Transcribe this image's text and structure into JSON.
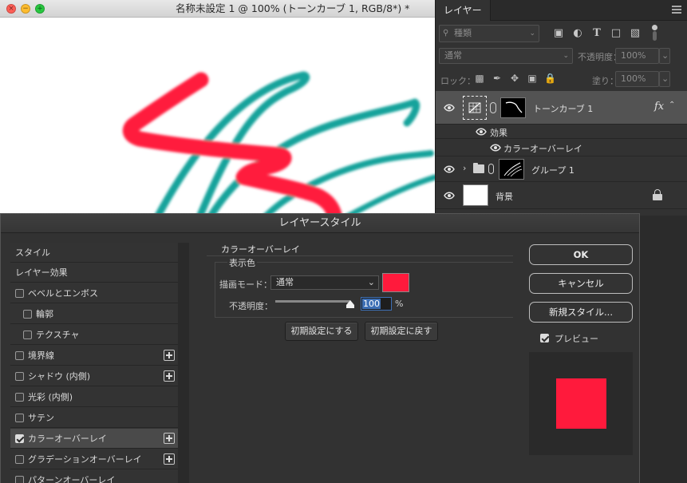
{
  "document": {
    "title": "名称未設定 1 @ 100% (トーンカーブ 1, RGB/8*) *",
    "window_controls": {
      "close": "×",
      "minimize": "−",
      "maximize": "+"
    }
  },
  "layers_panel": {
    "tab": "レイヤー",
    "filter_placeholder": "種類",
    "blend_mode": "通常",
    "opacity_label": "不透明度：",
    "opacity_value": "100%",
    "lock_label": "ロック：",
    "fill_label": "塗り：",
    "fill_value": "100%",
    "layers": [
      {
        "name": "トーンカーブ 1",
        "fx": "fx",
        "effects_label": "効果",
        "effect": "カラーオーバーレイ"
      },
      {
        "name": "グループ 1"
      },
      {
        "name": "背景"
      }
    ]
  },
  "dialog": {
    "title": "レイヤースタイル",
    "styles": [
      {
        "label": "スタイル"
      },
      {
        "label": "レイヤー効果"
      },
      {
        "label": "ベベルとエンボス",
        "checked": false
      },
      {
        "label": "輪郭",
        "checked": false
      },
      {
        "label": "テクスチャ",
        "checked": false
      },
      {
        "label": "境界線",
        "checked": false
      },
      {
        "label": "シャドウ (内側)",
        "checked": false
      },
      {
        "label": "光彩 (内側)",
        "checked": false
      },
      {
        "label": "サテン",
        "checked": false
      },
      {
        "label": "カラーオーバーレイ",
        "checked": true
      },
      {
        "label": "グラデーションオーバーレイ",
        "checked": false
      },
      {
        "label": "パターンオーバーレイ",
        "checked": false
      }
    ],
    "section_title": "カラーオーバーレイ",
    "subsection_title": "表示色",
    "blend_label": "描画モード：",
    "blend_value": "通常",
    "overlay_color": "#ff1a3c",
    "opacity_label": "不透明度：",
    "opacity_value": "100",
    "opacity_unit": "%",
    "opacity_level": 1.0,
    "make_default": "初期設定にする",
    "reset_default": "初期設定に戻す",
    "ok": "OK",
    "cancel": "キャンセル",
    "new_style": "新規スタイル...",
    "preview_label": "プレビュー",
    "preview_checked": true
  },
  "colors": {
    "stroke_red": "#ff1a3c",
    "stroke_teal": "#16a39b",
    "panel_bg": "#323232"
  }
}
